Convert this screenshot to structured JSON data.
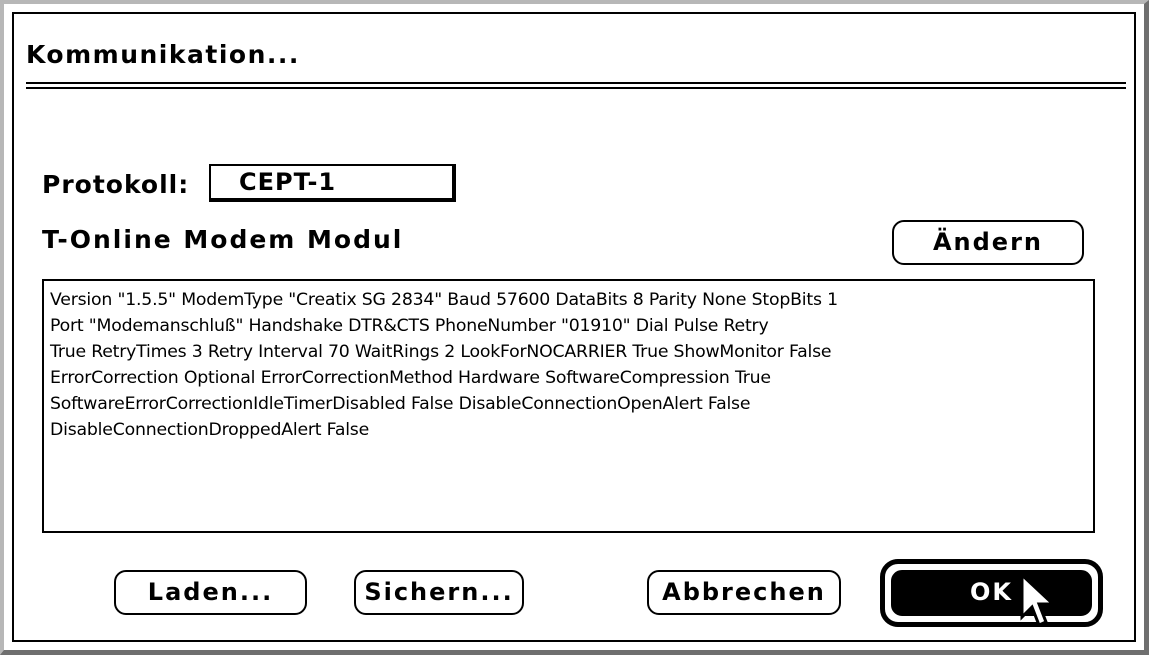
{
  "dialog": {
    "title": "Kommunikation..."
  },
  "protocol": {
    "label": "Protokoll:",
    "value": "CEPT-1"
  },
  "module": {
    "label": "T-Online Modem Modul",
    "change_button": "Ändern"
  },
  "settings_text": "Version \"1.5.5\" ModemType \"Creatix SG 2834\" Baud 57600 DataBits 8 Parity None StopBits 1\nPort \"Modemanschluß\" Handshake DTR&CTS PhoneNumber \"01910\" Dial Pulse Retry\nTrue RetryTimes 3 Retry Interval 70 WaitRings 2 LookForNOCARRIER True ShowMonitor False\nErrorCorrection Optional ErrorCorrectionMethod Hardware SoftwareCompression True\nSoftwareErrorCorrectionIdleTimerDisabled False DisableConnectionOpenAlert False\nDisableConnectionDroppedAlert False",
  "buttons": {
    "load": "Laden...",
    "save": "Sichern...",
    "cancel": "Abbrechen",
    "ok": "OK"
  },
  "cursor": {
    "icon": "arrow-cursor-icon"
  }
}
